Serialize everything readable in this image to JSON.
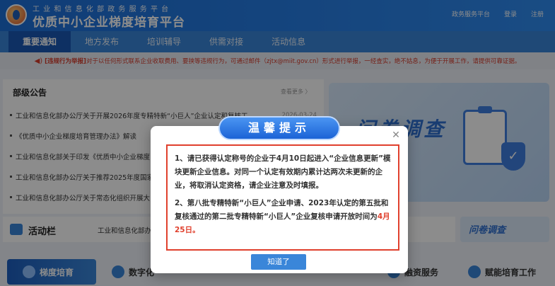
{
  "header": {
    "subtitle": "工 业 和 信 息 化 部 政 务 服 务 平 台",
    "title": "优质中小企业梯度培育平台",
    "links": [
      "政务服务平台",
      "登录",
      "注册"
    ]
  },
  "nav": {
    "items": [
      "重要通知",
      "地方发布",
      "培训辅导",
      "供需对接",
      "活动信息"
    ]
  },
  "notice": {
    "label": "[违规行为举报]",
    "text": "对于以任何形式联系企业收取费用、要挟等违规行为，可通过邮件（zjtx@miit.gov.cn）形式进行举报，一经查实，绝不姑息，为便于开展工作，请提供可靠证据。"
  },
  "news": {
    "title": "部级公告",
    "more": "查看更多 〉",
    "items": [
      {
        "title": "工业和信息化部办公厅关于开展2026年度专精特新“小巨人”企业认定和复核工...",
        "date": "2026-03-24"
      },
      {
        "title": "《优质中小企业梯度培育管理办法》解读",
        "date": ""
      },
      {
        "title": "工业和信息化部关于印发《优质中小企业梯度",
        "date": ""
      },
      {
        "title": "工业和信息化部办公厅关于推荐2025年度国家",
        "date": ""
      },
      {
        "title": "工业和信息化部办公厅关于常态化组织开展大",
        "date": ""
      }
    ]
  },
  "banner": {
    "text": "问卷调查"
  },
  "activity": {
    "title": "活动栏",
    "text": "工业和信息化部办"
  },
  "survey": {
    "label": "问卷调查"
  },
  "services": {
    "items": [
      "梯度培育",
      "数字化",
      "融资服务",
      "赋能培育工作"
    ]
  },
  "modal": {
    "title": "温馨提示",
    "close": "✕",
    "p1": "1、请已获得认定称号的企业于4月10日起进入“企业信息更新”模块更新企业信息。对同一个认定有效期内累计达两次未更新的企业，将取消认定资格，请企业注意及时填报。",
    "p2_prefix": "2、第八批专精特新“小巨人”企业申请、2023年认定的第五批和复核通过的第二批专精特新“小巨人”企业复核申请开放时间为",
    "p2_highlight": "4月25日。",
    "ok": "知道了"
  },
  "colors": {
    "primary": "#3a86d9",
    "alert": "#e0402d"
  }
}
